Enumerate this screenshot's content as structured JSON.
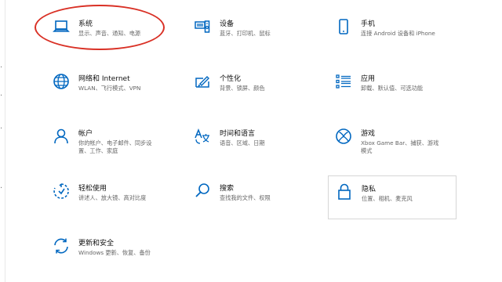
{
  "tiles": [
    {
      "name": "system",
      "icon": "laptop-icon",
      "title": "系统",
      "desc1": "显示、声音、通知、电源",
      "desc2": ""
    },
    {
      "name": "devices",
      "icon": "keyboard-speaker-icon",
      "title": "设备",
      "desc1": "蓝牙、打印机、鼠标",
      "desc2": ""
    },
    {
      "name": "phone",
      "icon": "phone-icon",
      "title": "手机",
      "desc1": "连接 Android 设备和 iPhone",
      "desc2": ""
    },
    {
      "name": "network",
      "icon": "globe-icon",
      "title": "网络和 Internet",
      "desc1": "WLAN、飞行模式、VPN",
      "desc2": ""
    },
    {
      "name": "personalization",
      "icon": "paint-brush-icon",
      "title": "个性化",
      "desc1": "背景、锁屏、颜色",
      "desc2": ""
    },
    {
      "name": "apps",
      "icon": "apps-list-icon",
      "title": "应用",
      "desc1": "卸载、默认值、可选功能",
      "desc2": ""
    },
    {
      "name": "accounts",
      "icon": "person-icon",
      "title": "帐户",
      "desc1": "你的帐户、电子邮件、同步设",
      "desc2": "置、工作、家庭"
    },
    {
      "name": "time-language",
      "icon": "time-language-icon",
      "title": "时间和语言",
      "desc1": "语音、区域、日期",
      "desc2": ""
    },
    {
      "name": "gaming",
      "icon": "xbox-icon",
      "title": "游戏",
      "desc1": "Xbox Game Bar、捕获、游戏",
      "desc2": "模式"
    },
    {
      "name": "ease-of-access",
      "icon": "ease-of-access-icon",
      "title": "轻松使用",
      "desc1": "讲述人、放大镜、高对比度",
      "desc2": ""
    },
    {
      "name": "search",
      "icon": "magnifier-icon",
      "title": "搜索",
      "desc1": "查找我的文件、权限",
      "desc2": ""
    },
    {
      "name": "privacy",
      "icon": "lock-icon",
      "title": "隐私",
      "desc1": "位置、相机、麦克风",
      "desc2": ""
    },
    {
      "name": "update-security",
      "icon": "sync-arrows-icon",
      "title": "更新和安全",
      "desc1": "Windows 更新、恢复、备份",
      "desc2": ""
    }
  ],
  "colors": {
    "accent": "#0067c0",
    "annotation": "#d93025"
  }
}
